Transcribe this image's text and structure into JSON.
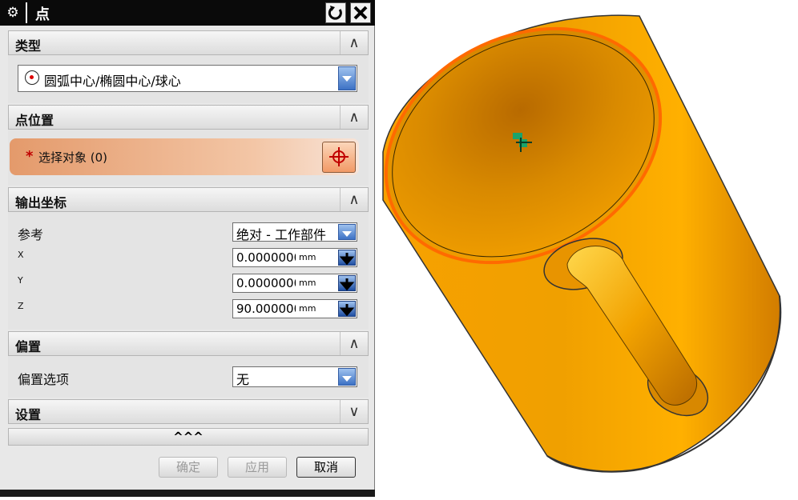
{
  "dialog": {
    "title": "点",
    "sections": {
      "type": {
        "label": "类型",
        "toggle": "∧"
      },
      "point_location": {
        "label": "点位置",
        "toggle": "∧"
      },
      "output_coords": {
        "label": "输出坐标",
        "toggle": "∧"
      },
      "offset": {
        "label": "偏置",
        "toggle": "∧"
      },
      "settings": {
        "label": "设置",
        "toggle": "∨"
      }
    },
    "type_select": {
      "value": "圆弧中心/椭圆中心/球心",
      "icon": "arc-center-icon"
    },
    "select_object": {
      "required_mark": "*",
      "label": "选择对象 (0)",
      "icon": "crosshair-icon"
    },
    "output": {
      "reference_label": "参考",
      "reference_value": "绝对 - 工作部件",
      "x_label": "X",
      "y_label": "Y",
      "z_label": "Z",
      "x_value": "0.0000000",
      "y_value": "0.0000000",
      "z_value": "90.0000000",
      "unit": "mm"
    },
    "offset": {
      "option_label": "偏置选项",
      "option_value": "无"
    },
    "more": "^^^",
    "buttons": {
      "ok": "确定",
      "apply": "应用",
      "cancel": "取消"
    }
  },
  "colors": {
    "mug_body": "#f59a00",
    "mug_edge": "#ff6a00",
    "selection_band": "#e49a6b"
  }
}
